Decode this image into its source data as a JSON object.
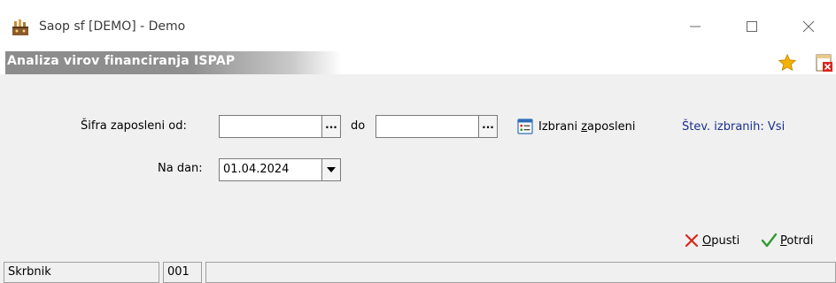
{
  "window": {
    "title": "Saop sf [DEMO] - Demo",
    "icon": "saop-app-icon",
    "controls": {
      "minimize": "minimize-icon",
      "maximize": "maximize-icon",
      "close": "close-icon"
    }
  },
  "form": {
    "title": "Analiza virov financiranja ISPAP",
    "header_icons": [
      "favorite-star-icon",
      "close-form-icon"
    ]
  },
  "filters": {
    "employee_from_label": "Šifra zaposleni od:",
    "employee_from_value": "",
    "to_label": "do",
    "employee_to_value": "",
    "ellipsis_label": "...",
    "selected_employees_label": "Izbrani zaposleni",
    "selected_count_label": "Štev. izbranih: Vsi",
    "date_label": "Na dan:",
    "date_value": "01.04.2024"
  },
  "actions": {
    "cancel_label": "Opusti",
    "confirm_label": "Potrdi"
  },
  "statusbar": {
    "user": "Skrbnik",
    "code": "001",
    "message": ""
  },
  "colors": {
    "header_band": "#8c8c8c",
    "link_blue": "#1a2f8f",
    "star": "#f5b301",
    "cancel_red": "#d9261c",
    "confirm_green": "#2e9a2e"
  }
}
